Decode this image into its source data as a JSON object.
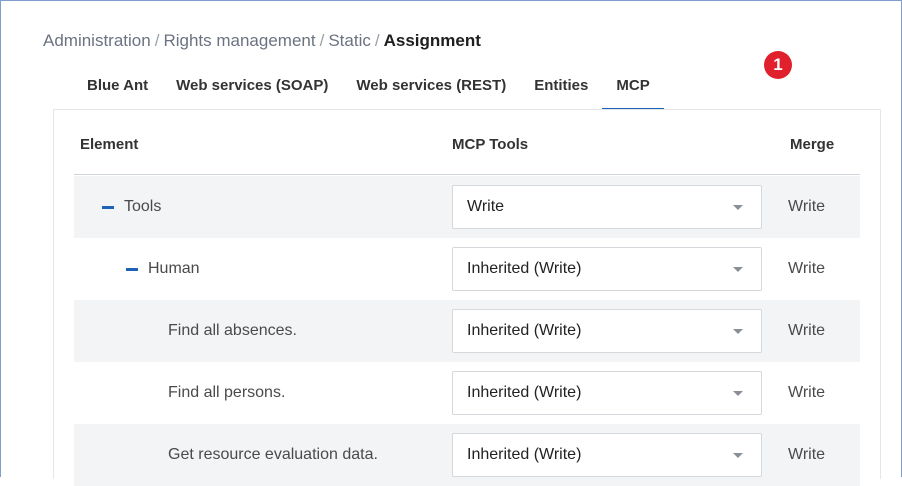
{
  "breadcrumb": {
    "items": [
      "Administration",
      "Rights management",
      "Static"
    ],
    "separator": "/",
    "current": "Assignment"
  },
  "tabs": [
    {
      "label": "Blue Ant",
      "active": false
    },
    {
      "label": "Web services (SOAP)",
      "active": false
    },
    {
      "label": "Web services (REST)",
      "active": false
    },
    {
      "label": "Entities",
      "active": false
    },
    {
      "label": "MCP",
      "active": true
    }
  ],
  "annotation_badge": "1",
  "table": {
    "headers": {
      "element": "Element",
      "tools": "MCP Tools",
      "merge": "Merge"
    },
    "rows": [
      {
        "element": "Tools",
        "level": 0,
        "collapsible": true,
        "value": "Write",
        "merge": "Write"
      },
      {
        "element": "Human",
        "level": 1,
        "collapsible": true,
        "value": "Inherited (Write)",
        "merge": "Write"
      },
      {
        "element": "Find all absences.",
        "level": 2,
        "collapsible": false,
        "value": "Inherited (Write)",
        "merge": "Write"
      },
      {
        "element": "Find all persons.",
        "level": 2,
        "collapsible": false,
        "value": "Inherited (Write)",
        "merge": "Write"
      },
      {
        "element": "Get resource evaluation data.",
        "level": 2,
        "collapsible": false,
        "value": "Inherited (Write)",
        "merge": "Write"
      }
    ]
  },
  "colors": {
    "accent": "#1d62b4",
    "badge": "#e0202c",
    "row_alt": "#f3f4f6"
  }
}
